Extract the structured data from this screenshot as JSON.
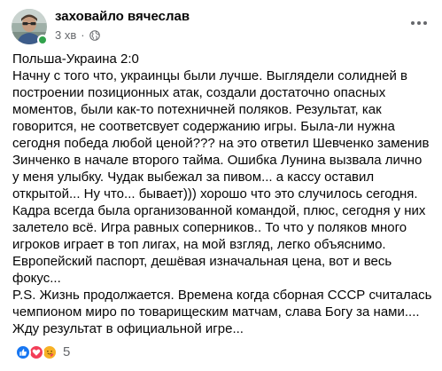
{
  "post": {
    "author_name": "заховайло вячеслав",
    "timestamp": "3 хв",
    "separator": "·",
    "audience_icon": "globe-icon",
    "more_icon": "more-options-icon",
    "online_status_color": "#31a24c"
  },
  "body": {
    "lines": [
      "Польша-Украина  2:0",
      "Начну с того что, украинцы были лучше. Выглядели солидней в",
      "построении позиционных атак, создали достаточно опасных",
      "моментов, были как-то потехничней поляков. Результат, как",
      "говорится, не соответсвует содержанию игры.  Была-ли нужна",
      "сегодня победа любой ценой??? на это ответил Шевченко заменив",
      "Зинченко в начале второго тайма. Ошибка Лунина вызвала лично",
      "у меня улыбку. Чудак выбежал за пивом... а кассу оставил",
      "открытой... Ну что... бывает))) хорошо что это случилось сегодня.",
      "Кадра всегда была организованной командой, плюс, сегодня у них",
      "залетело всё. Игра равных соперников.. То что у поляков много",
      "игроков играет в топ лигах, на мой взгляд, легко объяснимо.",
      "Европейский паспорт, дешёвая изначальная цена, вот и весь",
      "фокус...",
      "P.S. Жизнь продолжается. Времена когда сборная СССР считалась",
      "чемпионом миро по товарищеским матчам, слава Богу за нами....",
      "Жду результат в официальной игре..."
    ]
  },
  "reactions": {
    "icons": [
      "like-icon",
      "love-icon",
      "care-icon"
    ],
    "count": "5",
    "colors": {
      "like": "#1877f2",
      "love": "#f33e58",
      "care": "#f7b125"
    }
  }
}
